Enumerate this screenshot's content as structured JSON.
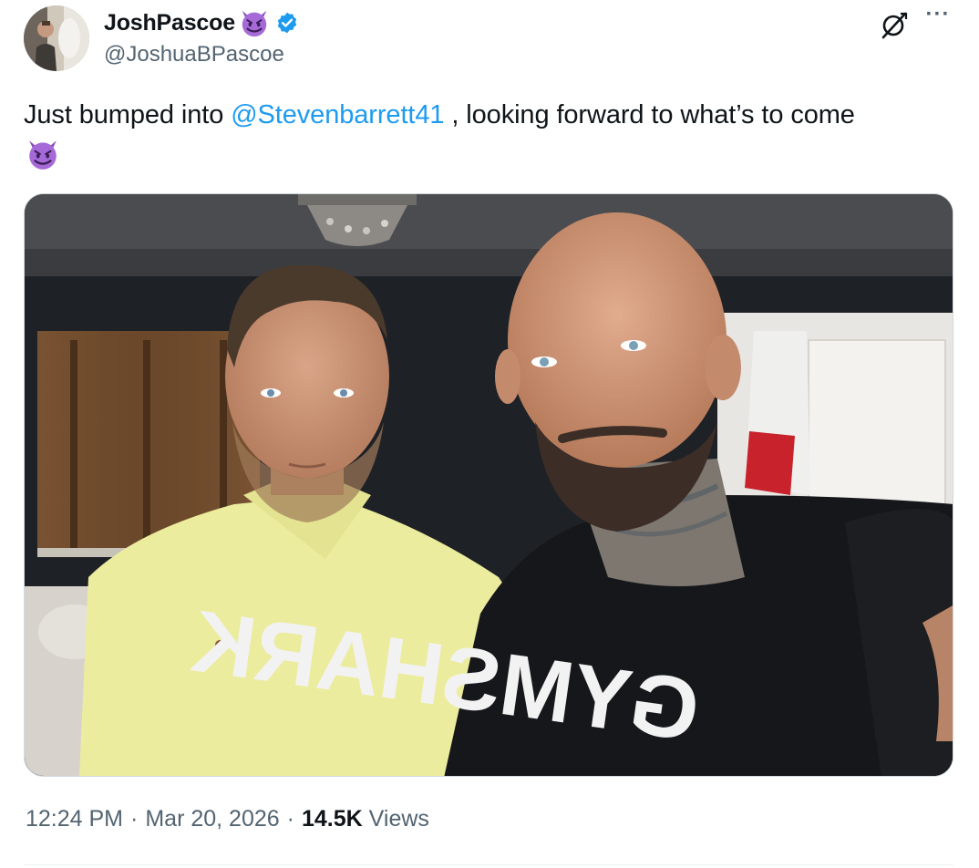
{
  "author": {
    "display_name": "JoshPascoe",
    "handle": "@JoshuaBPascoe",
    "verified_icon": "verified-badge-icon",
    "name_emoji_icon": "smiling-devil-emoji"
  },
  "header_actions": {
    "grok_icon": "grok-icon",
    "more_label": "···"
  },
  "tweet": {
    "text_before": "Just bumped into ",
    "mention": "@Stevenbarrett41",
    "text_after": " , looking forward to what’s to come",
    "trailing_emoji_icon": "smiling-devil-emoji"
  },
  "media": {
    "shirt_print": "GYMSHARK"
  },
  "meta": {
    "time": "12:24 PM",
    "separator": "·",
    "date": "Mar 20, 2026",
    "views_count": "14.5K",
    "views_label": "Views"
  },
  "colors": {
    "link": "#1d9bf0",
    "secondary_text": "#536471",
    "verified": "#1d9bf0",
    "devil_purple": "#9b59d0"
  }
}
